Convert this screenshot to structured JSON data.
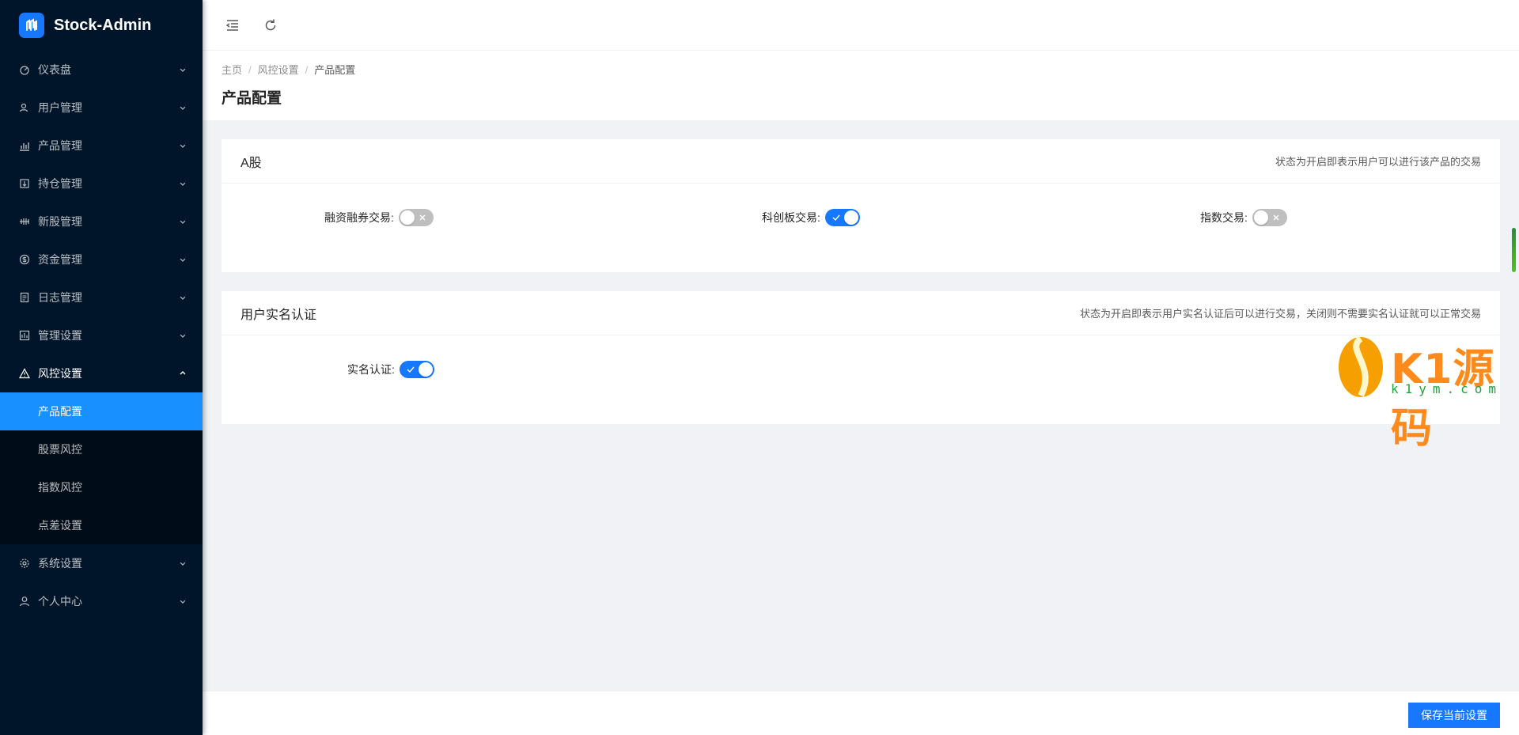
{
  "app": {
    "title": "Stock-Admin"
  },
  "sidebar": {
    "items": [
      {
        "label": "仪表盘",
        "icon": "dashboard-icon"
      },
      {
        "label": "用户管理",
        "icon": "users-icon"
      },
      {
        "label": "产品管理",
        "icon": "chart-icon"
      },
      {
        "label": "持仓管理",
        "icon": "position-icon"
      },
      {
        "label": "新股管理",
        "icon": "ipo-icon"
      },
      {
        "label": "资金管理",
        "icon": "dollar-icon"
      },
      {
        "label": "日志管理",
        "icon": "log-icon"
      },
      {
        "label": "管理设置",
        "icon": "admin-settings-icon"
      },
      {
        "label": "风控设置",
        "icon": "warning-icon",
        "open": true,
        "children": [
          "产品配置",
          "股票风控",
          "指数风控",
          "点差设置"
        ],
        "active_child": 0
      },
      {
        "label": "系统设置",
        "icon": "gear-icon"
      },
      {
        "label": "个人中心",
        "icon": "user-icon"
      }
    ]
  },
  "breadcrumb": {
    "home": "主页",
    "parent": "风控设置",
    "current": "产品配置"
  },
  "page": {
    "title": "产品配置"
  },
  "cards": {
    "a_share": {
      "title": "A股",
      "tip": "状态为开启即表示用户可以进行该产品的交易",
      "fields": [
        {
          "label": "融资融券交易:",
          "on": false
        },
        {
          "label": "科创板交易:",
          "on": true
        },
        {
          "label": "指数交易:",
          "on": false
        }
      ]
    },
    "real_name": {
      "title": "用户实名认证",
      "tip": "状态为开启即表示用户实名认证后可以进行交易，关闭则不需要实名认证就可以正常交易",
      "fields": [
        {
          "label": "实名认证:",
          "on": true
        }
      ]
    }
  },
  "watermark": {
    "brand": "K1源码",
    "domain": "k1ym.com"
  },
  "footer": {
    "save_label": "保存当前设置"
  },
  "colors": {
    "primary": "#1677ff",
    "sidebar_bg": "#001529",
    "active_bg": "#1890ff"
  }
}
